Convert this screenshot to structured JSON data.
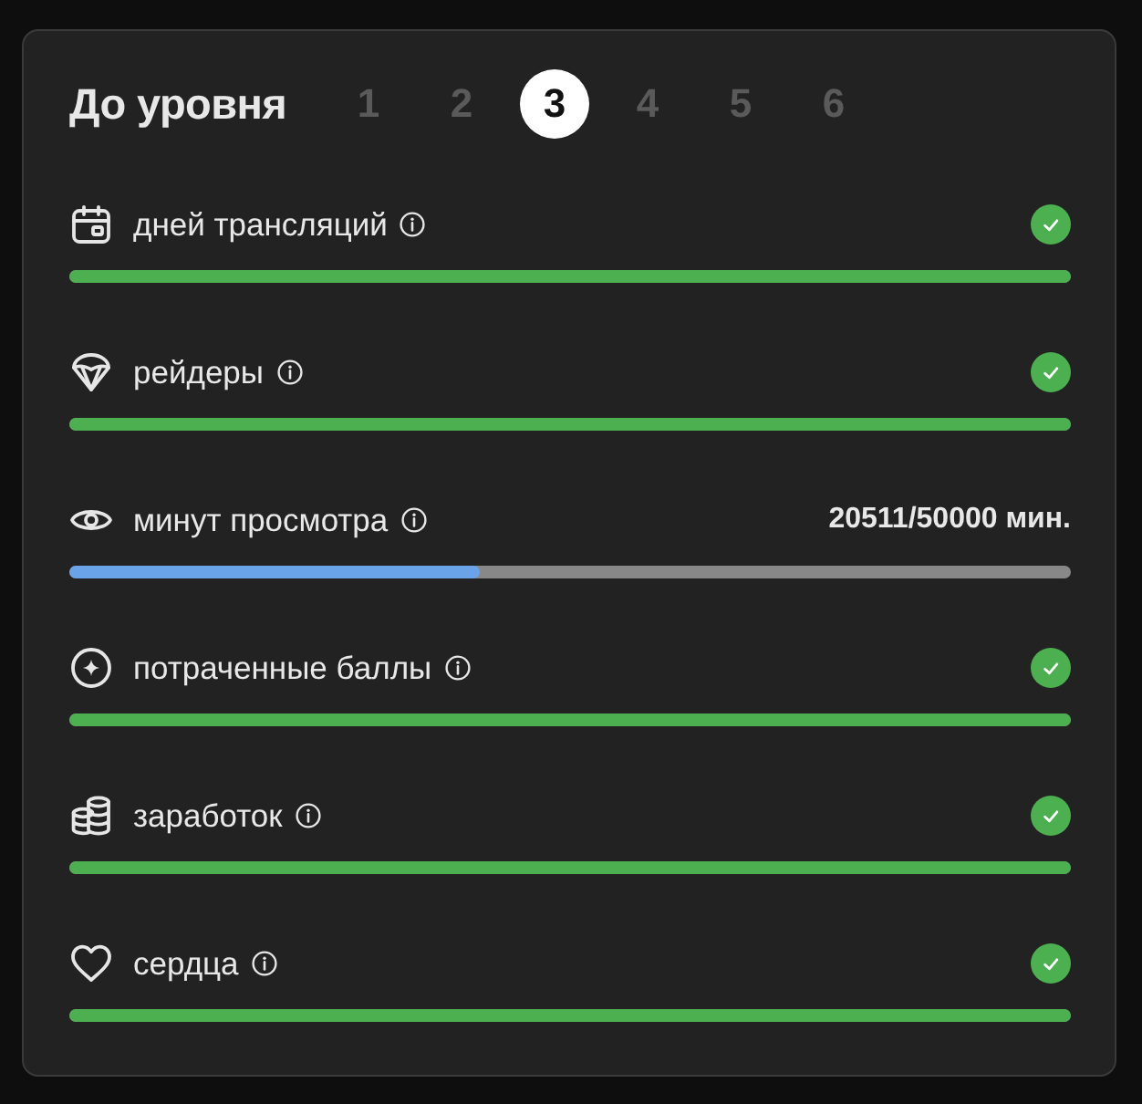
{
  "header": {
    "title": "До уровня",
    "levels": [
      {
        "label": "1",
        "selected": false
      },
      {
        "label": "2",
        "selected": false
      },
      {
        "label": "3",
        "selected": true
      },
      {
        "label": "4",
        "selected": false
      },
      {
        "label": "5",
        "selected": false
      },
      {
        "label": "6",
        "selected": false
      }
    ]
  },
  "goals": [
    {
      "label": "дней трансляций",
      "done": true,
      "level": 1
    },
    {
      "label": "рейдеры",
      "done": true,
      "level": 1
    },
    {
      "label": "минут просмотра",
      "done": false,
      "level": 0.41,
      "reading": "20511/50000 мин."
    },
    {
      "label": "потраченные баллы",
      "done": true,
      "level": 1
    },
    {
      "label": "заработок",
      "done": true,
      "level": 1
    },
    {
      "label": "сердца",
      "done": true,
      "level": 1
    }
  ]
}
